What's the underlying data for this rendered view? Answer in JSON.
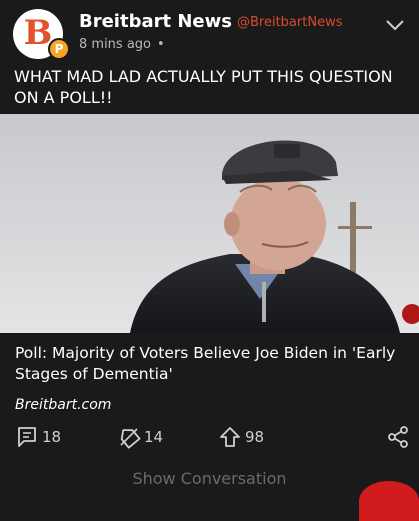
{
  "header": {
    "avatar_letter": "B",
    "badge_letter": "P",
    "display_name": "Breitbart News",
    "handle": "@BreitbartNews",
    "time": "8 mins ago",
    "dot": "•"
  },
  "tweet": {
    "text": "WHAT MAD LAD ACTUALLY PUT THIS QUESTION ON A POLL!!"
  },
  "card": {
    "title": "Poll: Majority of Voters Believe Joe Biden in 'Early Stages of Dementia'",
    "domain": "Breitbart.com"
  },
  "actions": {
    "replies": "18",
    "retweets": "14",
    "likes": "98"
  },
  "footer": {
    "show_conversation": "Show Conversation"
  },
  "colors": {
    "background": "#1a1a1a",
    "brand": "#e0532b",
    "handle": "#d94b2b",
    "badge": "#f5a623"
  },
  "icons": [
    "chevron-down-icon",
    "reply-icon",
    "retweet-icon",
    "upvote-icon",
    "share-icon"
  ]
}
